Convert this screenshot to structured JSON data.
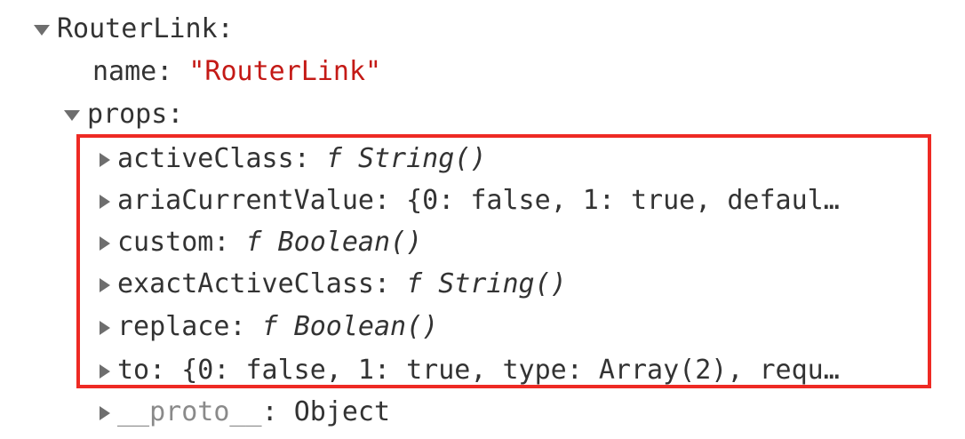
{
  "root": {
    "label": "RouterLink",
    "suffix": ":"
  },
  "name_row": {
    "key": "name",
    "sep": ": ",
    "value": "\"RouterLink\""
  },
  "props_row": {
    "key": "props",
    "suffix": ":"
  },
  "props": [
    {
      "key": "activeClass",
      "sep": ": ",
      "kw": "f",
      "value": "String()"
    },
    {
      "key": "ariaCurrentValue",
      "sep": ": ",
      "kw": "",
      "value": "{0: false, 1: true, defaul…"
    },
    {
      "key": "custom",
      "sep": ": ",
      "kw": "f",
      "value": "Boolean()"
    },
    {
      "key": "exactActiveClass",
      "sep": ": ",
      "kw": "f",
      "value": "String()"
    },
    {
      "key": "replace",
      "sep": ": ",
      "kw": "f",
      "value": "Boolean()"
    },
    {
      "key": "to",
      "sep": ": ",
      "kw": "",
      "value": "{0: false, 1: true, type: Array(2), requ…"
    }
  ],
  "proto_row": {
    "key": "__proto__",
    "sep": ": ",
    "value": "Object"
  },
  "colors": {
    "highlight_border": "#ee2a24",
    "string_value": "#c41a16",
    "text": "#333333",
    "proto_key": "#8a8a8a"
  }
}
